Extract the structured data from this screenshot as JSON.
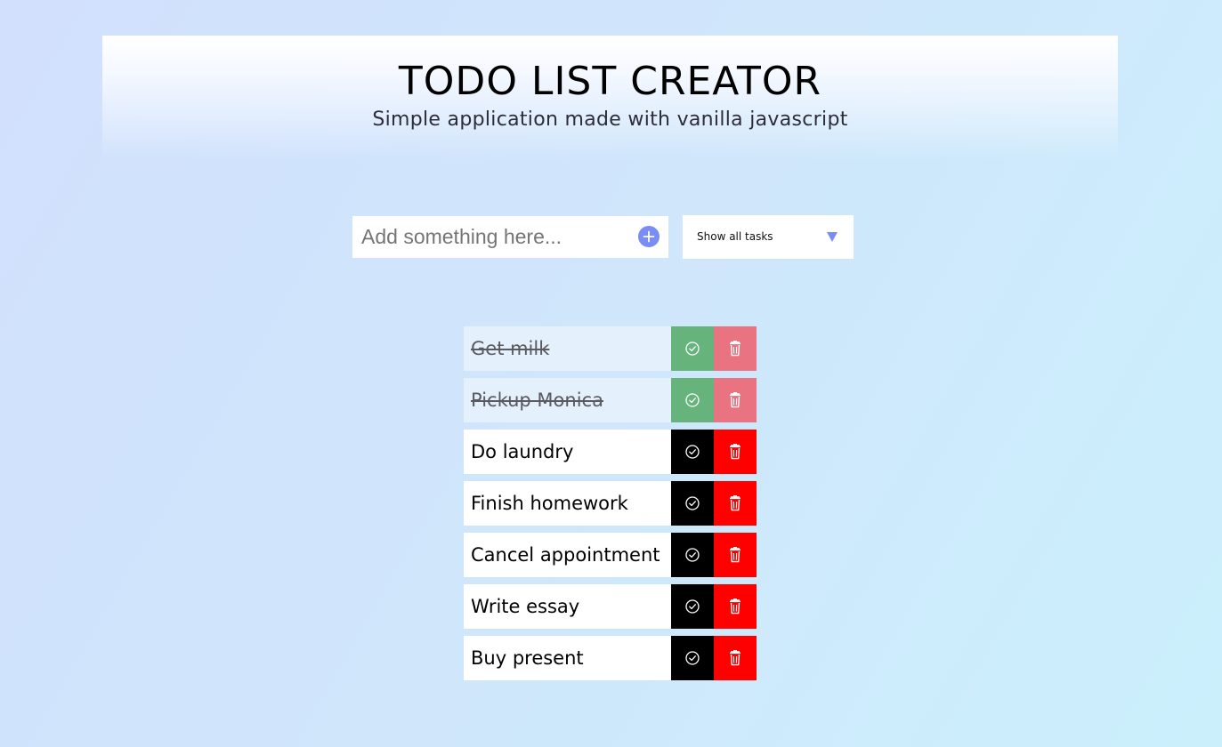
{
  "header": {
    "title": "TODO LIST CREATOR",
    "subtitle": "Simple application made with vanilla javascript"
  },
  "form": {
    "input_placeholder": "Add something here...",
    "input_value": "",
    "add_icon": "plus-circle-icon",
    "filter": {
      "selected": "Show all tasks",
      "arrow_icon": "triangle-down-icon"
    }
  },
  "todos": [
    {
      "text": "Get milk",
      "completed": true
    },
    {
      "text": "Pickup Monica",
      "completed": true
    },
    {
      "text": "Do laundry",
      "completed": false
    },
    {
      "text": "Finish homework",
      "completed": false
    },
    {
      "text": "Cancel appointment",
      "completed": false
    },
    {
      "text": "Write essay",
      "completed": false
    },
    {
      "text": "Buy present",
      "completed": false
    }
  ],
  "icons": {
    "check": "check-circle-icon",
    "trash": "trash-icon"
  },
  "colors": {
    "accent": "#7a8cf5",
    "check_active": "#000000",
    "trash_active": "#ff0000",
    "check_completed": "#66b47c",
    "trash_completed": "#e97380",
    "completed_text_bg": "#e4f1fd"
  }
}
